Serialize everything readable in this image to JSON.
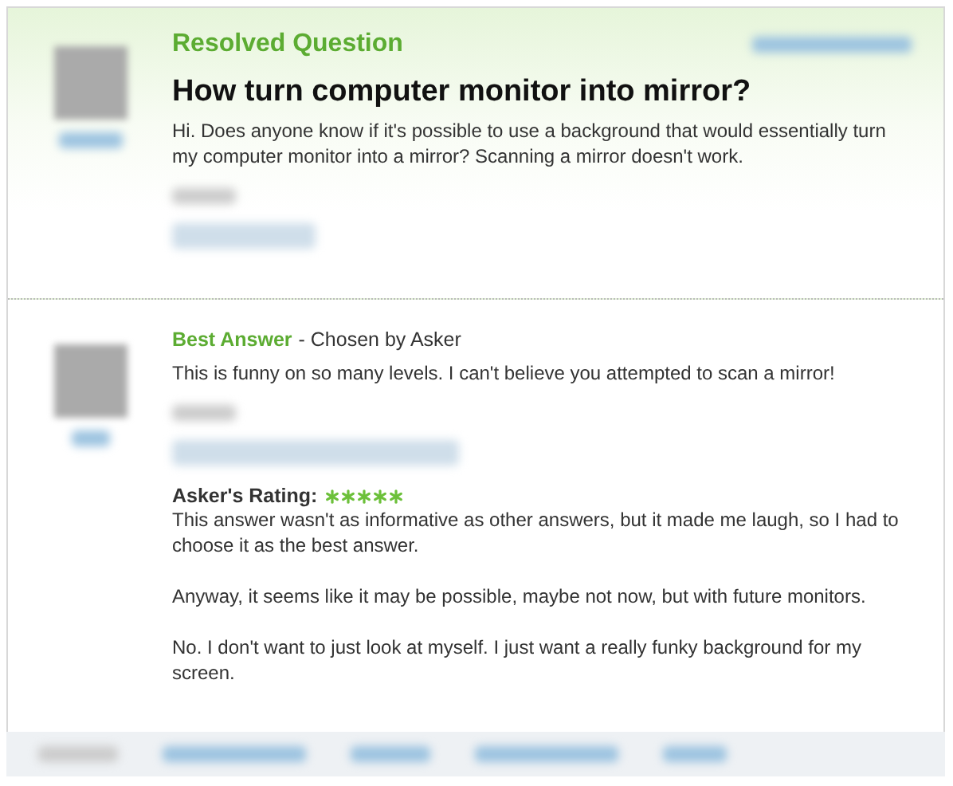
{
  "question": {
    "status": "Resolved Question",
    "title": "How turn computer monitor into mirror?",
    "body": "Hi. Does anyone know if it's possible to use a background that would essentially turn my computer monitor into a mirror? Scanning a mirror doesn't work."
  },
  "best_answer": {
    "label": "Best Answer",
    "chosen_by": "- Chosen by Asker",
    "body": "This is funny on so many levels. I can't believe you attempted to scan a mirror!",
    "rating": {
      "label": "Asker's Rating:",
      "stars": 5
    },
    "comment": [
      "This answer wasn't as informative as other answers, but it made me laugh, so I had to choose it as the best answer.",
      "Anyway, it seems like it may be possible, maybe not now, but with future monitors.",
      "No. I don't want to just look at myself. I just want a really funky background for my screen."
    ]
  }
}
